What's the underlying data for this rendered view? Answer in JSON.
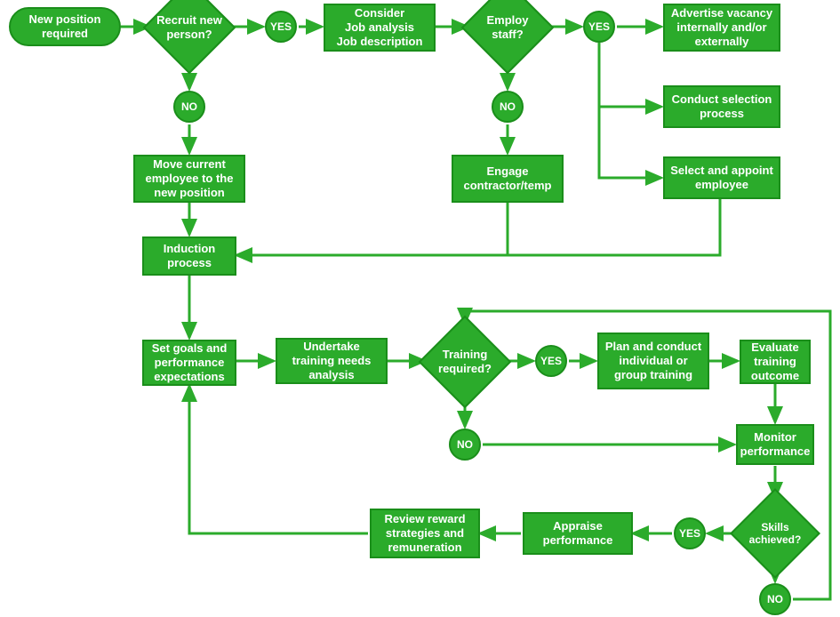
{
  "nodes": {
    "new_position": "New position required",
    "recruit": "Recruit new person?",
    "recruit_yes": "YES",
    "recruit_no": "NO",
    "consider": "Consider\nJob analysis\nJob description",
    "employ": "Employ staff?",
    "employ_yes": "YES",
    "employ_no": "NO",
    "advertise": "Advertise vacancy internally and/or externally",
    "conduct_selection": "Conduct selection process",
    "select_appoint": "Select and appoint employee",
    "move_current": "Move current employee to the new position",
    "engage_contractor": "Engage contractor/temp",
    "induction": "Induction process",
    "set_goals": "Set goals and performance expectations",
    "undertake": "Undertake training needs analysis",
    "training": "Training required?",
    "training_yes": "YES",
    "training_no": "NO",
    "plan_conduct": "Plan and conduct individual or group training",
    "evaluate": "Evaluate training outcome",
    "monitor": "Monitor performance",
    "skills": "Skills achieved?",
    "skills_yes": "YES",
    "skills_no": "NO",
    "appraise": "Appraise performance",
    "review_reward": "Review reward strategies and remuneration"
  },
  "chart_data": {
    "type": "flowchart",
    "nodes": [
      {
        "id": "new_position",
        "type": "terminator",
        "label": "New position required"
      },
      {
        "id": "recruit",
        "type": "decision",
        "label": "Recruit new person?"
      },
      {
        "id": "consider",
        "type": "process",
        "label": "Consider Job analysis Job description"
      },
      {
        "id": "employ",
        "type": "decision",
        "label": "Employ staff?"
      },
      {
        "id": "advertise",
        "type": "process",
        "label": "Advertise vacancy internally and/or externally"
      },
      {
        "id": "conduct_selection",
        "type": "process",
        "label": "Conduct selection process"
      },
      {
        "id": "select_appoint",
        "type": "process",
        "label": "Select and appoint employee"
      },
      {
        "id": "move_current",
        "type": "process",
        "label": "Move current employee to the new position"
      },
      {
        "id": "engage_contractor",
        "type": "process",
        "label": "Engage contractor/temp"
      },
      {
        "id": "induction",
        "type": "process",
        "label": "Induction process"
      },
      {
        "id": "set_goals",
        "type": "process",
        "label": "Set goals and performance expectations"
      },
      {
        "id": "undertake",
        "type": "process",
        "label": "Undertake training needs analysis"
      },
      {
        "id": "training",
        "type": "decision",
        "label": "Training required?"
      },
      {
        "id": "plan_conduct",
        "type": "process",
        "label": "Plan and conduct individual or group training"
      },
      {
        "id": "evaluate",
        "type": "process",
        "label": "Evaluate training outcome"
      },
      {
        "id": "monitor",
        "type": "process",
        "label": "Monitor performance"
      },
      {
        "id": "skills",
        "type": "decision",
        "label": "Skills achieved?"
      },
      {
        "id": "appraise",
        "type": "process",
        "label": "Appraise performance"
      },
      {
        "id": "review_reward",
        "type": "process",
        "label": "Review reward strategies and remuneration"
      }
    ],
    "edges": [
      {
        "from": "new_position",
        "to": "recruit"
      },
      {
        "from": "recruit",
        "to": "consider",
        "label": "YES"
      },
      {
        "from": "recruit",
        "to": "move_current",
        "label": "NO"
      },
      {
        "from": "consider",
        "to": "employ"
      },
      {
        "from": "employ",
        "to": "advertise",
        "label": "YES"
      },
      {
        "from": "employ",
        "to": "conduct_selection",
        "label": "YES"
      },
      {
        "from": "employ",
        "to": "select_appoint",
        "label": "YES"
      },
      {
        "from": "employ",
        "to": "engage_contractor",
        "label": "NO"
      },
      {
        "from": "move_current",
        "to": "induction"
      },
      {
        "from": "engage_contractor",
        "to": "induction"
      },
      {
        "from": "select_appoint",
        "to": "induction"
      },
      {
        "from": "induction",
        "to": "set_goals"
      },
      {
        "from": "set_goals",
        "to": "undertake"
      },
      {
        "from": "undertake",
        "to": "training"
      },
      {
        "from": "training",
        "to": "plan_conduct",
        "label": "YES"
      },
      {
        "from": "training",
        "to": "monitor",
        "label": "NO"
      },
      {
        "from": "plan_conduct",
        "to": "evaluate"
      },
      {
        "from": "evaluate",
        "to": "monitor"
      },
      {
        "from": "monitor",
        "to": "skills"
      },
      {
        "from": "skills",
        "to": "appraise",
        "label": "YES"
      },
      {
        "from": "skills",
        "to": "training",
        "label": "NO"
      },
      {
        "from": "appraise",
        "to": "review_reward"
      },
      {
        "from": "review_reward",
        "to": "set_goals"
      }
    ]
  }
}
